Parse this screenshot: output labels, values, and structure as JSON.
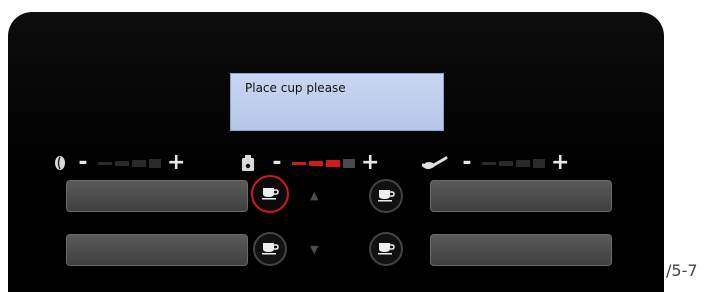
{
  "display": {
    "message": "Place cup please"
  },
  "controls": {
    "bean": {
      "icon": "coffee-bean-icon",
      "minus": "-",
      "plus": "+"
    },
    "water": {
      "icon": "water-tank-icon",
      "minus": "-",
      "plus": "+",
      "level": "active"
    },
    "milk": {
      "icon": "milk-spout-icon",
      "minus": "-",
      "plus": "+"
    }
  },
  "arrows": {
    "up": "▲",
    "down": "▼"
  },
  "footer": {
    "page_marker": "/5-7"
  },
  "colors": {
    "accent": "#d11a1a",
    "panel": "#040404",
    "lcd": "#c2d1ef"
  }
}
